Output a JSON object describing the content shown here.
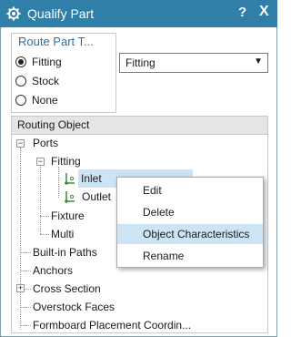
{
  "window": {
    "title": "Qualify Part",
    "help_label": "?",
    "close_label": "X"
  },
  "route_part_type": {
    "group_label": "Route Part T...",
    "options": [
      {
        "label": "Fitting",
        "checked": true
      },
      {
        "label": "Stock",
        "checked": false
      },
      {
        "label": "None",
        "checked": false
      }
    ],
    "selected_value": "Fitting"
  },
  "routing_object": {
    "header": "Routing Object",
    "tree": {
      "ports": "Ports",
      "fitting": "Fitting",
      "inlet": "Inlet",
      "outlet": "Outlet",
      "fixture": "Fixture",
      "multi": "Multi",
      "built_in_paths": "Built-in Paths",
      "anchors": "Anchors",
      "cross_section": "Cross Section",
      "overstock_faces": "Overstock Faces",
      "formboard": "Formboard Placement Coordin..."
    }
  },
  "context_menu": {
    "items": [
      {
        "label": "Edit"
      },
      {
        "label": "Delete"
      },
      {
        "label": "Object Characteristics"
      },
      {
        "label": "Rename"
      }
    ]
  },
  "colors": {
    "title_bar": "#2f7fa8",
    "highlight": "#cde4f5",
    "port_icon": "#3a8a3a"
  }
}
